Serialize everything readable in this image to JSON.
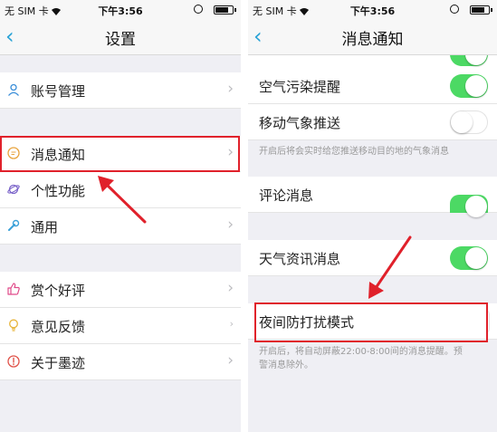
{
  "status_bar": {
    "carrier": "无 SIM 卡",
    "time": "下午3:56"
  },
  "left": {
    "title": "设置",
    "items": [
      {
        "label": "账号管理",
        "icon": "person-icon"
      },
      {
        "label": "消息通知",
        "icon": "chat-bubble-icon"
      },
      {
        "label": "个性功能",
        "icon": "planet-icon"
      },
      {
        "label": "通用",
        "icon": "wrench-icon"
      },
      {
        "label": "赏个好评",
        "icon": "thumbs-up-icon"
      },
      {
        "label": "意见反馈",
        "icon": "lightbulb-icon"
      },
      {
        "label": "关于墨迹",
        "icon": "info-icon"
      }
    ]
  },
  "right": {
    "title": "消息通知",
    "items": [
      {
        "label": "空气污染提醒",
        "toggle": true
      },
      {
        "label": "移动气象推送",
        "toggle": false
      },
      {
        "label": "评论消息",
        "toggle": true
      },
      {
        "label": "天气资讯消息",
        "toggle": true
      },
      {
        "label": "夜间防打扰模式",
        "toggle": false
      }
    ],
    "mobile_push_desc": "开启后将会实时给您推送移动目的地的气象消息",
    "night_mode_desc": "开启后，将自动屏蔽22:00-8:00间的消息提醒。预警消息除外。"
  },
  "colors": {
    "accent": "#2aa3d6",
    "toggle_on": "#4cd964",
    "highlight": "#e0212b"
  }
}
